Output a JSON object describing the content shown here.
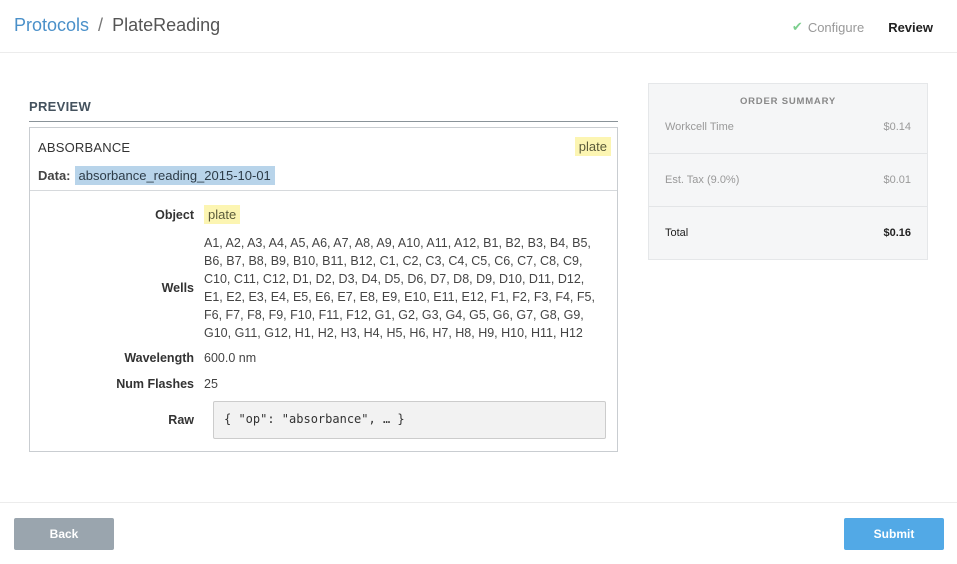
{
  "header": {
    "breadcrumb_root": "Protocols",
    "breadcrumb_separator": "/",
    "breadcrumb_current": "PlateReading",
    "steps": {
      "configure": "Configure",
      "review": "Review"
    }
  },
  "preview": {
    "heading": "PREVIEW",
    "operation": {
      "name": "ABSORBANCE",
      "object_chip": "plate",
      "data_label": "Data:",
      "data_value": "absorbance_reading_2015-10-01"
    },
    "fields": {
      "object_label": "Object",
      "object_value": "plate",
      "wells_label": "Wells",
      "wells_value": "A1, A2, A3, A4, A5, A6, A7, A8, A9, A10, A11, A12, B1, B2, B3, B4, B5, B6, B7, B8, B9, B10, B11, B12, C1, C2, C3, C4, C5, C6, C7, C8, C9, C10, C11, C12, D1, D2, D3, D4, D5, D6, D7, D8, D9, D10, D11, D12, E1, E2, E3, E4, E5, E6, E7, E8, E9, E10, E11, E12, F1, F2, F3, F4, F5, F6, F7, F8, F9, F10, F11, F12, G1, G2, G3, G4, G5, G6, G7, G8, G9, G10, G11, G12, H1, H2, H3, H4, H5, H6, H7, H8, H9, H10, H11, H12",
      "wavelength_label": "Wavelength",
      "wavelength_value": "600.0 nm",
      "flashes_label": "Num Flashes",
      "flashes_value": "25",
      "raw_label": "Raw",
      "raw_value": "{ \"op\": \"absorbance\", … }"
    }
  },
  "summary": {
    "title": "ORDER SUMMARY",
    "rows": [
      {
        "label": "Workcell Time",
        "value": "$0.14"
      },
      {
        "label": "Est. Tax (9.0%)",
        "value": "$0.01"
      },
      {
        "label": "Total",
        "value": "$0.16"
      }
    ]
  },
  "footer": {
    "back_label": "Back",
    "submit_label": "Submit"
  },
  "colors": {
    "link": "#4a90c9",
    "chip_yellow": "#fcf5b2",
    "data_blue": "#b8d4ea",
    "submit": "#52a9e6",
    "back": "#9aa5ae",
    "check_green": "#7ccf8e"
  },
  "icons": {
    "configure_done": "check-icon"
  }
}
